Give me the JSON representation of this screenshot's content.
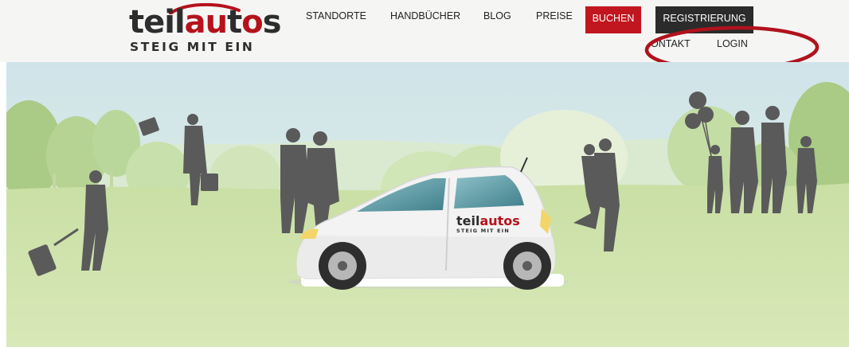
{
  "logo": {
    "word_dark_1": "teil",
    "word_red": "au",
    "word_dark_2": "t",
    "word_red_2": "o",
    "word_dark_3": "s",
    "tagline": "STEIG MIT EIN"
  },
  "nav": {
    "items": [
      "STANDORTE",
      "HANDBÜCHER",
      "BLOG",
      "PREISE"
    ],
    "buchen": "BUCHEN",
    "registrierung": "REGISTRIERUNG",
    "kontakt": "ONTAKT",
    "login": "LOGIN"
  },
  "car_logo": {
    "word_dark": "teil",
    "word_red": "autos",
    "tagline": "STEIG MIT EIN"
  },
  "colors": {
    "brand_red": "#c1161f",
    "dark": "#2b2b2b",
    "annotation": "#b0121c"
  }
}
